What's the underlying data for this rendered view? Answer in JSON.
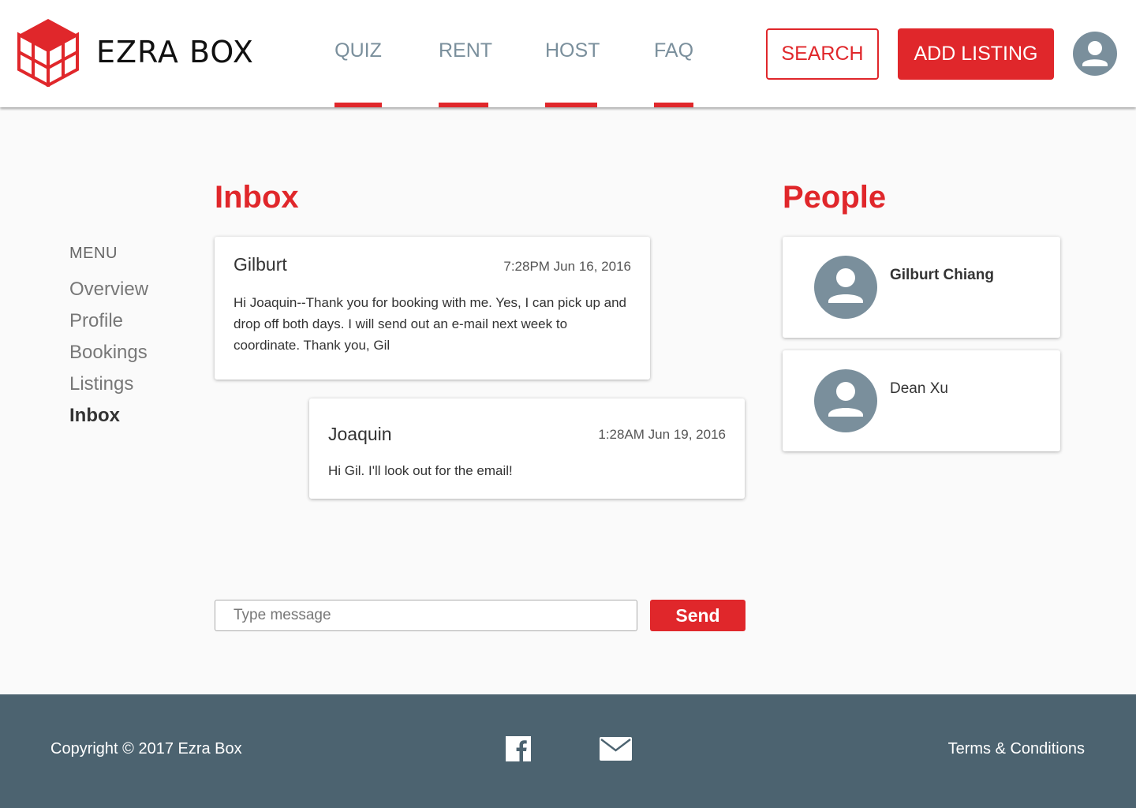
{
  "header": {
    "brand": "EZRA BOX",
    "nav": [
      {
        "label": "QUIZ"
      },
      {
        "label": "RENT"
      },
      {
        "label": "HOST"
      },
      {
        "label": "FAQ"
      }
    ],
    "search_label": "SEARCH",
    "add_listing_label": "ADD LISTING",
    "accent_color": "#e0272b"
  },
  "sidebar": {
    "menu_label": "MENU",
    "items": [
      {
        "label": "Overview"
      },
      {
        "label": "Profile"
      },
      {
        "label": "Bookings"
      },
      {
        "label": "Listings"
      },
      {
        "label": "Inbox",
        "active": true
      }
    ]
  },
  "inbox": {
    "title": "Inbox",
    "messages": [
      {
        "sender": "Gilburt",
        "time": "7:28PM Jun 16, 2016",
        "body": "Hi Joaquin--Thank you for booking with me. Yes, I can pick up and drop off both days. I will send out an e-mail next week to coordinate. Thank you, Gil"
      },
      {
        "sender": "Joaquin",
        "time": "1:28AM Jun 19, 2016",
        "body": "Hi Gil. I'll look out for the email!"
      }
    ],
    "input_placeholder": "Type message",
    "send_label": "Send"
  },
  "people": {
    "title": "People",
    "list": [
      {
        "name": "Gilburt Chiang",
        "selected": true
      },
      {
        "name": "Dean Xu",
        "selected": false
      }
    ]
  },
  "footer": {
    "copyright": "Copyright © 2017 Ezra Box",
    "terms": "Terms & Conditions",
    "icons": [
      "facebook-icon",
      "mail-icon"
    ],
    "background_color": "#4c6370"
  }
}
